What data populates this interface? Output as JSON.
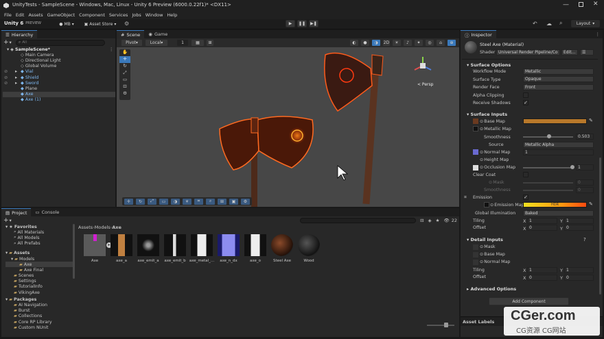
{
  "window": {
    "title": "UnityTests - SampleScene - Windows, Mac, Linux - Unity 6 Preview (6000.0.22f1)* <DX11>"
  },
  "menu": [
    "File",
    "Edit",
    "Assets",
    "GameObject",
    "Component",
    "Services",
    "Jobs",
    "Window",
    "Help"
  ],
  "toolbar": {
    "product": "Unity 6",
    "product_sub": "PREVIEW",
    "account": "MB",
    "store": "Asset Store",
    "layout": "Layout"
  },
  "hierarchy": {
    "tab": "Hierarchy",
    "search_placeholder": "All",
    "scene": "SampleScene*",
    "items": [
      "Main Camera",
      "Directional Light",
      "Global Volume",
      "Vial",
      "Shield",
      "Sword",
      "Plane",
      "Axe",
      "Axe (1)"
    ]
  },
  "scene": {
    "tab_scene": "Scene",
    "tab_game": "Game",
    "pivot": "Pivot",
    "local": "Local",
    "grid_value": "1",
    "persp": "< Persp"
  },
  "project": {
    "tab_project": "Project",
    "tab_console": "Console",
    "breadcrumb": [
      "Assets",
      "Models",
      "Axe"
    ],
    "count": "22",
    "tree": {
      "favorites": "Favorites",
      "fav_items": [
        "All Materials",
        "All Models",
        "All Prefabs"
      ],
      "assets": "Assets",
      "models": "Models",
      "model_items": [
        "Axe",
        "Axe Final"
      ],
      "asset_items": [
        "Scenes",
        "Settings",
        "TutorialInfo",
        "VikingAxe"
      ],
      "packages": "Packages",
      "package_items": [
        "AI Navigation",
        "Burst",
        "Collections",
        "Core RP Library",
        "Custom NUnit"
      ]
    },
    "assets": [
      "Axe",
      "axe_a",
      "axe_emit_a",
      "axe_emit_b",
      "axe_metal_...",
      "axe_n_dx",
      "axe_o",
      "Steel Axe",
      "Wood"
    ]
  },
  "inspector": {
    "tab": "Inspector",
    "material": "Steel Axe (Material)",
    "shader_label": "Shader",
    "shader_value": "Universal Render Pipeline/Co",
    "edit": "Edit...",
    "surface_options": "Surface Options",
    "workflow_label": "Workflow Mode",
    "workflow_value": "Metallic",
    "surface_type_label": "Surface Type",
    "surface_type_value": "Opaque",
    "render_face_label": "Render Face",
    "render_face_value": "Front",
    "alpha_label": "Alpha Clipping",
    "receive_label": "Receive Shadows",
    "surface_inputs": "Surface Inputs",
    "base_map": "Base Map",
    "metallic_map": "Metallic Map",
    "smoothness": "Smoothness",
    "smoothness_value": "0.503",
    "source_label": "Source",
    "source_value": "Metallic Alpha",
    "normal_map": "Normal Map",
    "normal_value": "1",
    "height_map": "Height Map",
    "occlusion_map": "Occlusion Map",
    "occlusion_value": "1",
    "clear_coat": "Clear Coat",
    "mask": "Mask",
    "mask_value": "0",
    "cc_smooth": "Smoothness",
    "cc_smooth_value": "0",
    "emission": "Emission",
    "emission_map": "Emission Map",
    "hdr": "HDR",
    "gi_label": "Global Illumination",
    "gi_value": "Baked",
    "tiling": "Tiling",
    "offset": "Offset",
    "x": "X",
    "y": "Y",
    "tiling_x": "1",
    "tiling_y": "1",
    "offset_x": "0",
    "offset_y": "0",
    "detail_inputs": "Detail Inputs",
    "d_mask": "Mask",
    "d_base": "Base Map",
    "d_normal": "Normal Map",
    "d_tiling_x": "1",
    "d_tiling_y": "1",
    "d_offset_x": "0",
    "d_offset_y": "0",
    "advanced": "Advanced Options",
    "add_component": "Add Component",
    "asset_labels": "Asset Labels"
  },
  "watermark": {
    "main": "CGer.com",
    "sub": "CG资源  CG网站"
  },
  "colors": {
    "accent": "#3a79bb",
    "base_map_color": "#b8782a",
    "selection": "#2c5d87"
  }
}
